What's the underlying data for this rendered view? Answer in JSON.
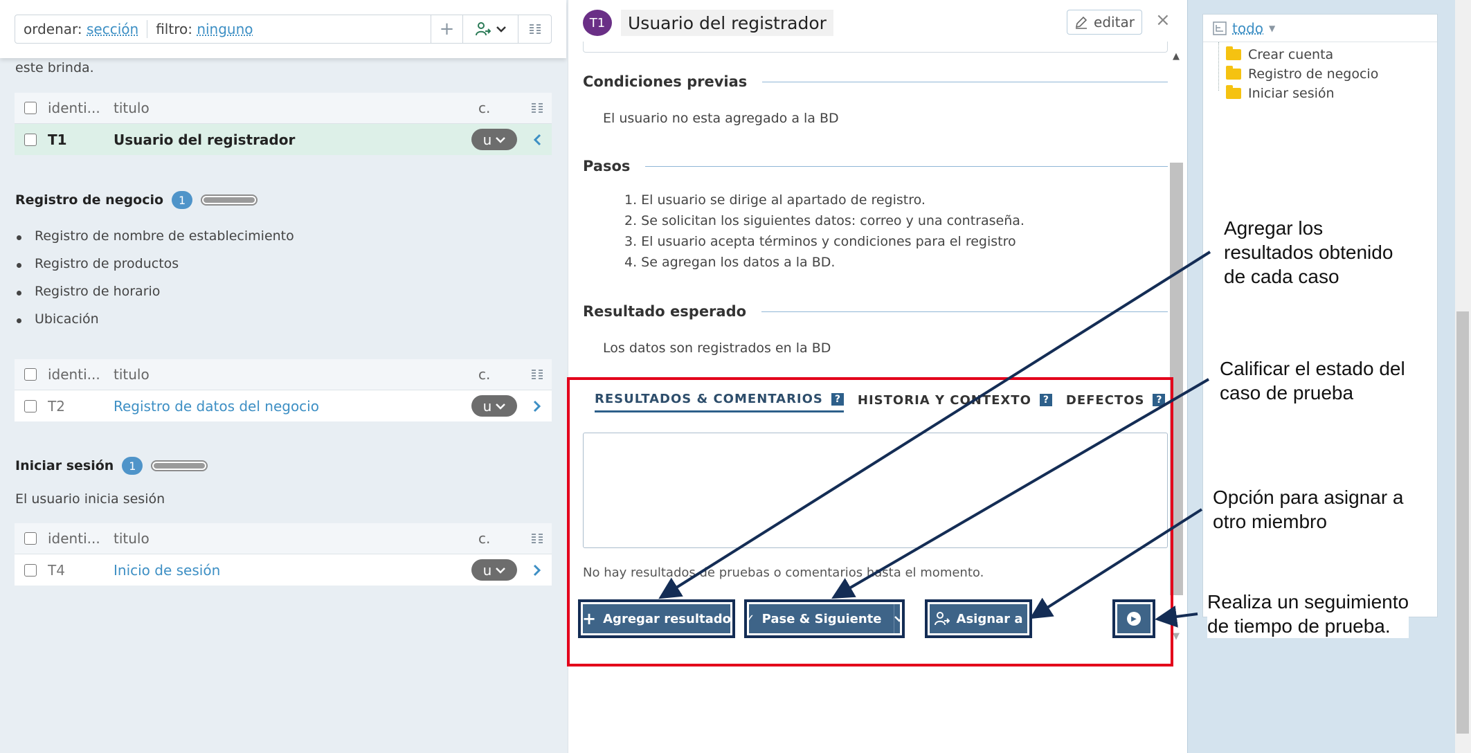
{
  "toolbar": {
    "sort_label": "ordenar:",
    "sort_value": "sección",
    "filter_label": "filtro:",
    "filter_value": "ninguno",
    "add_icon": "+",
    "assign_icon": "assign-user-icon",
    "chevron": "⌄",
    "columns_icon": "columns-icon"
  },
  "left": {
    "intro_text": "este brinda.",
    "table_header": {
      "id": "identi...",
      "title": "titulo",
      "c": "c."
    },
    "group1_row": {
      "id": "T1",
      "title": "Usuario del registrador",
      "pill": "u"
    },
    "section2": {
      "title": "Registro de negocio",
      "count": "1",
      "progress": 1.0,
      "bullets": [
        "Registro de nombre de establecimiento",
        "Registro de productos",
        "Registro de horario",
        "Ubicación"
      ],
      "row": {
        "id": "T2",
        "title": "Registro de datos del negocio",
        "pill": "u"
      }
    },
    "section3": {
      "title": "Iniciar sesión",
      "count": "1",
      "progress": 1.0,
      "description": "El usuario inicia sesión",
      "row": {
        "id": "T4",
        "title": "Inicio de sesión",
        "pill": "u"
      }
    }
  },
  "detail": {
    "avatar": "T1",
    "title": "Usuario del registrador",
    "edit_label": "editar",
    "close": "×",
    "preconditions_title": "Condiciones previas",
    "preconditions_text": "El usuario no esta agregado a la BD",
    "steps_title": "Pasos",
    "steps": [
      "1. El usuario se dirige al apartado de registro.",
      "2. Se solicitan los siguientes datos: correo y una contraseña.",
      "3. El usuario acepta términos y condiciones para el registro",
      "4. Se agregan los datos a la BD."
    ],
    "expected_title": "Resultado esperado",
    "expected_text": "Los datos son registrados en la BD",
    "tabs": [
      {
        "label": "RESULTADOS & COMENTARIOS",
        "help": "?"
      },
      {
        "label": "HISTORIA Y CONTEXTO",
        "help": "?"
      },
      {
        "label": "DEFECTOS",
        "help": "?"
      }
    ],
    "no_results": "No hay resultados de pruebas o comentarios hasta el momento.",
    "btn_add": "Agregar resultado",
    "btn_add_icon": "+",
    "btn_pass": "Pase & Siguiente",
    "btn_pass_icon": "✓",
    "btn_assign": "Asignar a",
    "btn_timer_icon": "play-icon"
  },
  "tree": {
    "root_label": "todo",
    "items": [
      "Crear cuenta",
      "Registro de negocio",
      "Iniciar sesión"
    ]
  },
  "annotations": {
    "a1": [
      "Agregar los",
      "resultados obtenido",
      "de cada caso"
    ],
    "a2": [
      "Calificar el estado del",
      "caso de prueba"
    ],
    "a3": [
      "Opción para asignar a",
      "otro miembro"
    ],
    "a4": [
      "Realiza un seguimiento",
      "de tiempo de prueba."
    ]
  },
  "colors": {
    "highlight_frame": "#e3001b",
    "arrow": "#142d55",
    "button": "#3e6488",
    "link": "#3d8fc4",
    "avatar": "#6a2f86"
  }
}
